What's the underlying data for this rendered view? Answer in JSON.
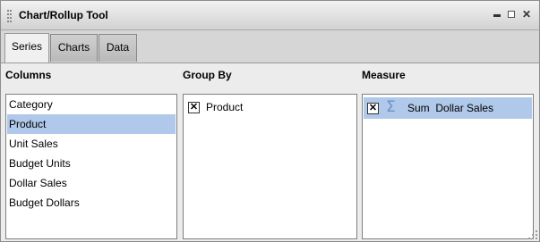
{
  "window": {
    "title": "Chart/Rollup Tool",
    "close_glyph": "✕"
  },
  "tabs": [
    {
      "label": "Series",
      "active": true
    },
    {
      "label": "Charts",
      "active": false
    },
    {
      "label": "Data",
      "active": false
    }
  ],
  "columns": {
    "header": "Columns",
    "items": [
      "Category",
      "Product",
      "Unit Sales",
      "Budget Units",
      "Dollar Sales",
      "Budget Dollars"
    ],
    "selected": "Product"
  },
  "group_by": {
    "header": "Group By",
    "items": [
      {
        "label": "Product",
        "checked": true
      }
    ]
  },
  "measure": {
    "header": "Measure",
    "items": [
      {
        "function": "Sum",
        "label": "Dollar Sales",
        "checked": true,
        "icon": "sigma-icon"
      }
    ]
  },
  "colors": {
    "selection": "#b0c8ea",
    "sigma": "#6f8fc8"
  },
  "glyphs": {
    "check": "✕",
    "sigma": "Σ"
  }
}
